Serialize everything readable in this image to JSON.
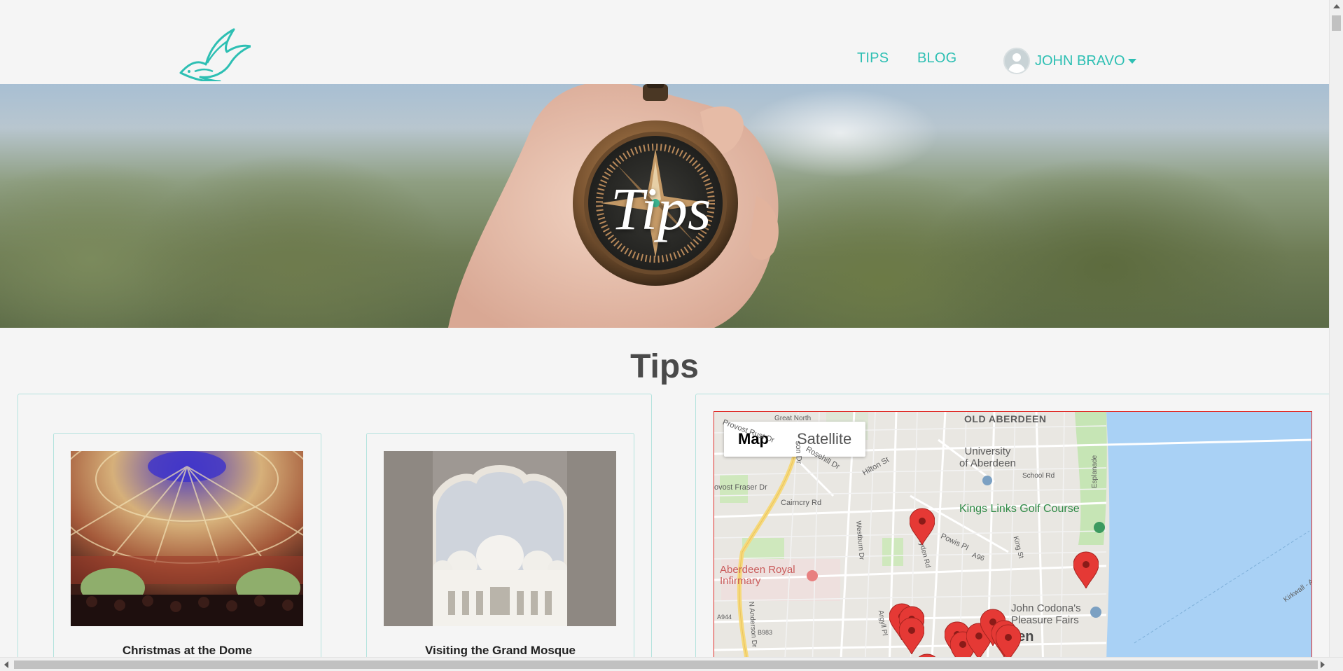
{
  "header": {
    "logo_icon": "swallow-bird-logo-icon",
    "nav": [
      {
        "label": "TIPS"
      },
      {
        "label": "BLOG"
      }
    ],
    "user": {
      "name": "JOHN BRAVO",
      "avatar_icon": "user-avatar-icon",
      "caret_icon": "caret-down-icon"
    }
  },
  "hero": {
    "title": "Tips",
    "image": "hand-holding-compass-photo"
  },
  "page": {
    "title": "Tips"
  },
  "tips": [
    {
      "title": "Christmas at the Dome",
      "image": "dome-ceiling-photo"
    },
    {
      "title": "Visiting the Grand Mosque",
      "image": "grand-mosque-arch-photo"
    }
  ],
  "map": {
    "toggle": [
      {
        "label": "Map",
        "active": true
      },
      {
        "label": "Satellite",
        "active": false
      }
    ],
    "labels": {
      "old_aberdeen": "OLD ABERDEEN",
      "university": "University\nof Aberdeen",
      "kings_links": "Kings Links Golf Course",
      "infirmary": "Aberdeen Royal\nInfirmary",
      "pleasure_fairs": "John Codona's\nPleasure Fairs",
      "city": "rdeen",
      "great_north": "Great North",
      "provost_rust": "Provost Rust Dr",
      "rosehill": "Rosehill Dr",
      "hilton": "Hilton St",
      "provost_fraser": "ovost Fraser Dr",
      "cairncry": "Cairncry Rd",
      "school_rd": "School Rd",
      "esplanade": "Esplanade",
      "kings_st": "King St",
      "powis": "Powis Pl",
      "a96": "A96",
      "westburn": "Westburn Dr",
      "berryden": "Berryden Rd",
      "n_anderson": "N Anderson Dr",
      "a944": "A944",
      "b983": "B983",
      "argyll": "Argyll Pl",
      "kirkwall": "Kirkwall - A",
      "anderson_dr": "son Dr"
    },
    "marker_icon": "map-pin-icon"
  },
  "colors": {
    "accent": "#2dbfb3",
    "panel_border": "#b5e3de",
    "page_bg": "#f5f5f5",
    "marker": "#e53935"
  }
}
